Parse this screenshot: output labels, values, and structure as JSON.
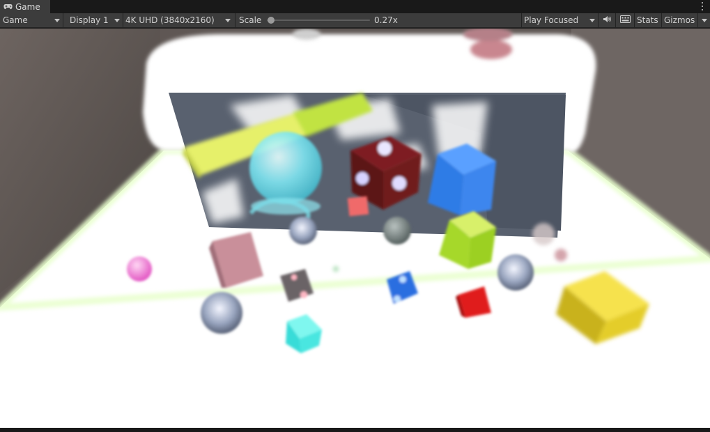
{
  "tab": {
    "icon": "gamepad-icon",
    "label": "Game"
  },
  "toolbar": {
    "view_mode": "Game",
    "display": "Display 1",
    "resolution": "4K UHD (3840x2160)",
    "scale_label": "Scale",
    "scale_value": "0.27x",
    "scale_fraction": 0.02,
    "play_mode": "Play Focused",
    "audio_icon": "speaker-icon",
    "keyboard_icon": "keyboard-icon",
    "stats": "Stats",
    "gizmos": "Gizmos"
  },
  "menu_icon": "kebab-menu-icon"
}
